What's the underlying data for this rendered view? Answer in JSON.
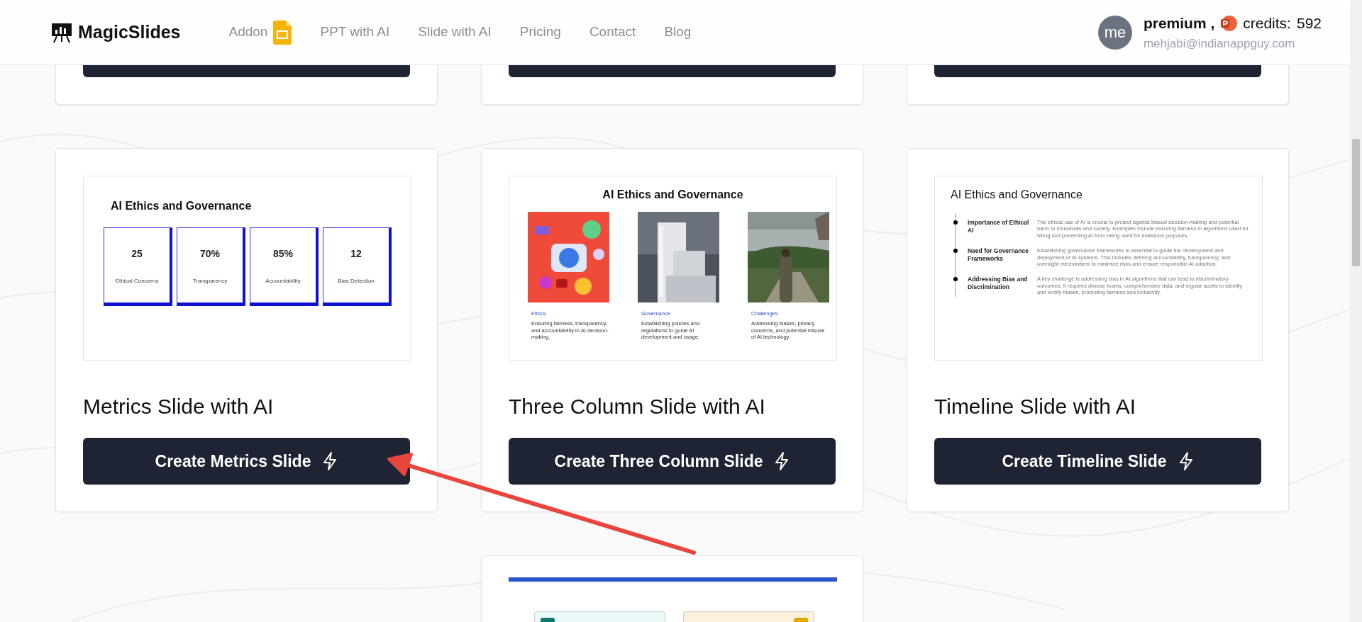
{
  "navbar": {
    "logo": "MagicSlides",
    "links": [
      {
        "label": "Addon",
        "kind": "with_icon"
      },
      {
        "label": "PPT with AI",
        "kind": "text"
      },
      {
        "label": "Slide with AI",
        "kind": "text"
      },
      {
        "label": "Pricing",
        "kind": "text"
      },
      {
        "label": "Contact",
        "kind": "text"
      },
      {
        "label": "Blog",
        "kind": "text"
      }
    ],
    "user": {
      "avatar": "me",
      "plan": "premium ,",
      "credits_label": "credits:",
      "credits": "592",
      "email": "mehjabi@indianappguy.com"
    }
  },
  "top_cards": [
    {
      "kind": "partial"
    },
    {
      "kind": "partial"
    },
    {
      "kind": "partial"
    }
  ],
  "cards": [
    {
      "title": "Metrics Slide with AI",
      "button": "Create Metrics Slide",
      "preview": {
        "kind": "metrics",
        "title": "AI Ethics and Governance",
        "metrics": [
          {
            "value": "25",
            "label": "Ethical Concerns"
          },
          {
            "value": "70%",
            "label": "Transparency"
          },
          {
            "value": "85%",
            "label": "Accountability"
          },
          {
            "value": "12",
            "label": "Bias Detection"
          }
        ]
      }
    },
    {
      "title": "Three Column Slide with AI",
      "button": "Create Three Column Slide",
      "preview": {
        "kind": "three_column",
        "title": "AI Ethics and Governance",
        "columns": [
          {
            "heading": "Ethics",
            "text": "Ensuring fairness, transparency, and accountability in AI decision-making."
          },
          {
            "heading": "Governance",
            "text": "Establishing policies and regulations to guide AI development and usage."
          },
          {
            "heading": "Challenges",
            "text": "Addressing biases, privacy concerns, and potential misuse of AI technology."
          }
        ]
      }
    },
    {
      "title": "Timeline Slide with AI",
      "button": "Create Timeline Slide",
      "preview": {
        "kind": "timeline",
        "title": "AI Ethics and Governance",
        "items": [
          {
            "heading": "Importance of Ethical AI",
            "text": "The ethical use of AI is crucial to protect against biased decision-making and potential harm to individuals and society. Examples include ensuring fairness in algorithms used for hiring and preventing AI from being used for malicious purposes."
          },
          {
            "heading": "Need for Governance Frameworks",
            "text": "Establishing governance frameworks is essential to guide the development and deployment of AI systems. This includes defining accountability, transparency, and oversight mechanisms to minimize risks and ensure responsible AI adoption."
          },
          {
            "heading": "Addressing Bias and Discrimination",
            "text": "A key challenge is addressing bias in AI algorithms that can lead to discriminatory outcomes. It requires diverse teams, comprehensive data, and regular audits to identify and rectify biases, promoting fairness and inclusivity."
          }
        ]
      }
    }
  ],
  "bottom_card": {
    "preview": {
      "kind": "swot",
      "boxes": [
        {
          "color": "#0f766e"
        },
        {
          "color": "#e0a800"
        }
      ]
    }
  }
}
